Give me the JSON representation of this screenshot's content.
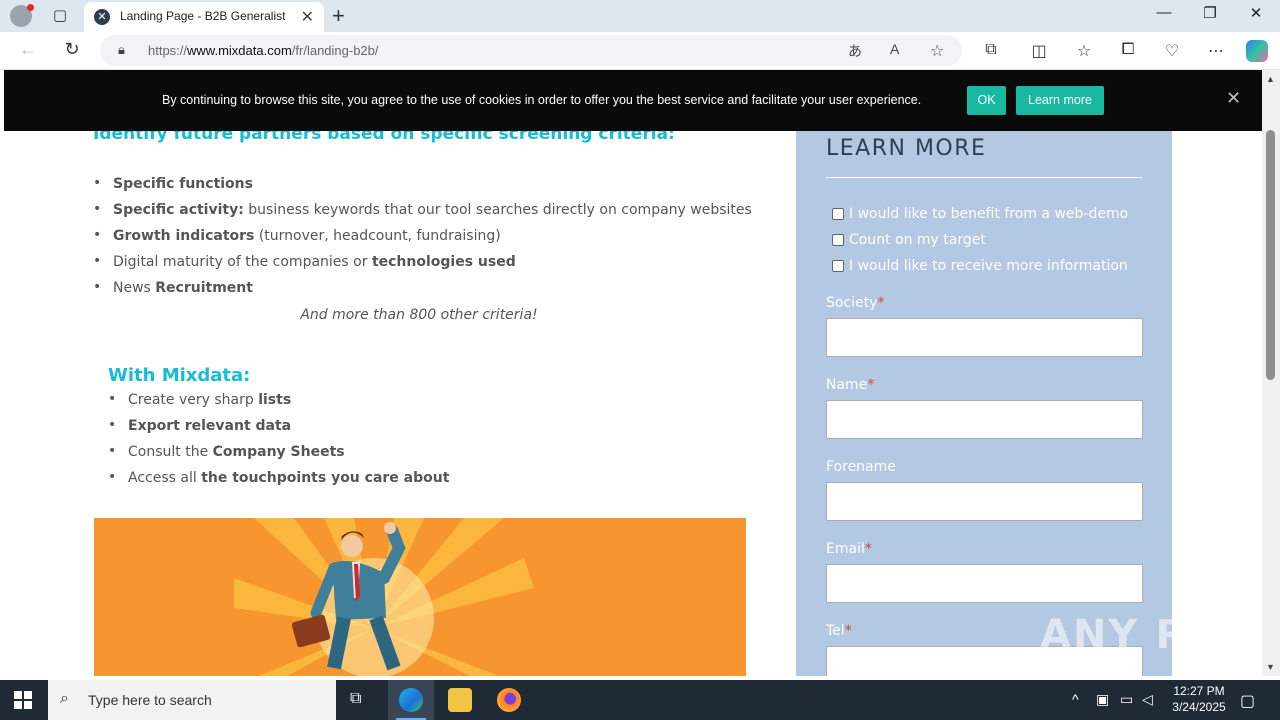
{
  "browser": {
    "tab_title": "Landing Page - B2B Generalist",
    "tab_close": "✕",
    "new_tab": "+",
    "url_prefix": "https://",
    "url_domain": "www.mixdata.com",
    "url_path": "/fr/landing-b2b/",
    "window_minimize": "—",
    "window_restore": "❐",
    "window_close": "✕"
  },
  "cookie_banner": {
    "message": "By continuing to browse this site, you agree to the use of cookies in order to offer you the best service and facilitate your user experience.",
    "ok_label": "OK",
    "learn_more_label": "Learn more",
    "close": "✕"
  },
  "main": {
    "heading1": "Identify future partners based on specific screening criteria:",
    "criteria_list": [
      {
        "bold": "Specific functions",
        "text": ""
      },
      {
        "bold": "Specific activity:",
        "text": " business keywords that our tool searches directly on company websites"
      },
      {
        "bold": "Growth indicators",
        "text": " (turnover, headcount, fundraising)"
      },
      {
        "pre": "Digital maturity of the companies or ",
        "bold": "technologies used"
      },
      {
        "pre": "News ",
        "bold": "Recruitment"
      }
    ],
    "criteria_note": "And more than 800 other criteria!",
    "heading2": "With Mixdata:",
    "mixdata_list": [
      {
        "pre": "Create very sharp ",
        "bold": "lists"
      },
      {
        "pre": "",
        "bold": "Export relevant data"
      },
      {
        "pre": "Consult the ",
        "bold": "Company Sheets"
      },
      {
        "pre": "Access all ",
        "bold": "the touchpoints you care about"
      }
    ]
  },
  "sidebar": {
    "title": "LEARN MORE",
    "checkboxes": [
      "I would like to benefit from a web-demo",
      "Count on my target",
      "I would like to receive more information"
    ],
    "fields": [
      {
        "label": "Society",
        "required": true
      },
      {
        "label": "Name",
        "required": true
      },
      {
        "label": "Forename",
        "required": false
      },
      {
        "label": "Email",
        "required": true
      },
      {
        "label": "Tel",
        "required": true
      }
    ],
    "required_mark": "*"
  },
  "watermark": "ANY RUN",
  "taskbar": {
    "search_placeholder": "Type here to search",
    "time": "12:27 PM",
    "date": "3/24/2025"
  },
  "colors": {
    "accent_teal": "#14bcd6",
    "cookie_button": "#19b8a0",
    "sidebar_bg": "#b3c8e2",
    "hero_bg": "#f7952e"
  }
}
